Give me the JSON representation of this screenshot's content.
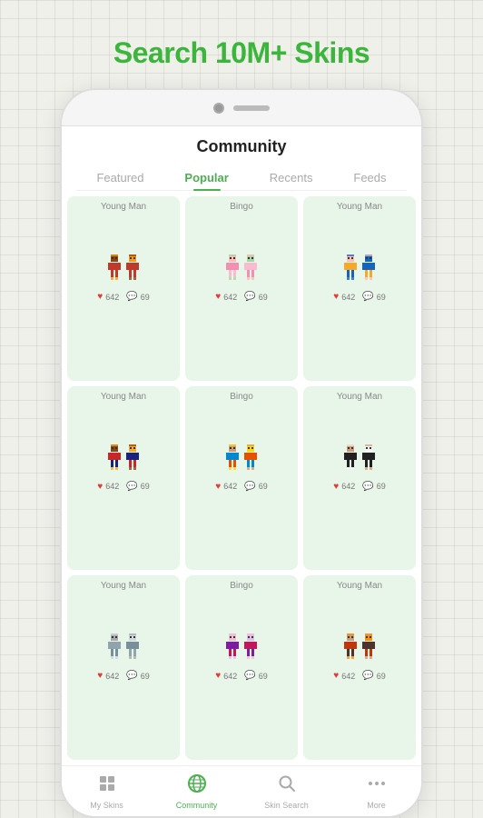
{
  "app_title": "Search 10M+ Skins",
  "phone": {
    "screen_title": "Community",
    "tabs": [
      {
        "label": "Featured",
        "active": false
      },
      {
        "label": "Popular",
        "active": true
      },
      {
        "label": "Recents",
        "active": false
      },
      {
        "label": "Feeds",
        "active": false
      }
    ],
    "skins": [
      {
        "name": "Young Man",
        "likes": "642",
        "comments": "69",
        "color1": "#c0392b",
        "color2": "#922b21"
      },
      {
        "name": "Bingo",
        "likes": "642",
        "comments": "69",
        "color1": "#f8bbd0",
        "color2": "#a5d6a7"
      },
      {
        "name": "Young Man",
        "likes": "642",
        "comments": "69",
        "color1": "#1565c0",
        "color2": "#f9a825"
      },
      {
        "name": "Young Man",
        "likes": "642",
        "comments": "69",
        "color1": "#1a237e",
        "color2": "#c62828"
      },
      {
        "name": "Bingo",
        "likes": "642",
        "comments": "69",
        "color1": "#0288d1",
        "color2": "#e65100"
      },
      {
        "name": "Young Man",
        "likes": "642",
        "comments": "69",
        "color1": "#212121",
        "color2": "#f5f5f5"
      },
      {
        "name": "Young Man",
        "likes": "642",
        "comments": "69",
        "color1": "#90a4ae",
        "color2": "#78909c"
      },
      {
        "name": "Bingo",
        "likes": "642",
        "comments": "69",
        "color1": "#7b1fa2",
        "color2": "#c2185b"
      },
      {
        "name": "Young Man",
        "likes": "642",
        "comments": "69",
        "color1": "#bf360c",
        "color2": "#4e342e"
      }
    ],
    "bottom_nav": [
      {
        "label": "My Skins",
        "icon": "🎮",
        "active": false
      },
      {
        "label": "Community",
        "icon": "🌐",
        "active": true
      },
      {
        "label": "Skin Search",
        "icon": "🔍",
        "active": false
      },
      {
        "label": "More",
        "icon": "•••",
        "active": false
      }
    ]
  }
}
